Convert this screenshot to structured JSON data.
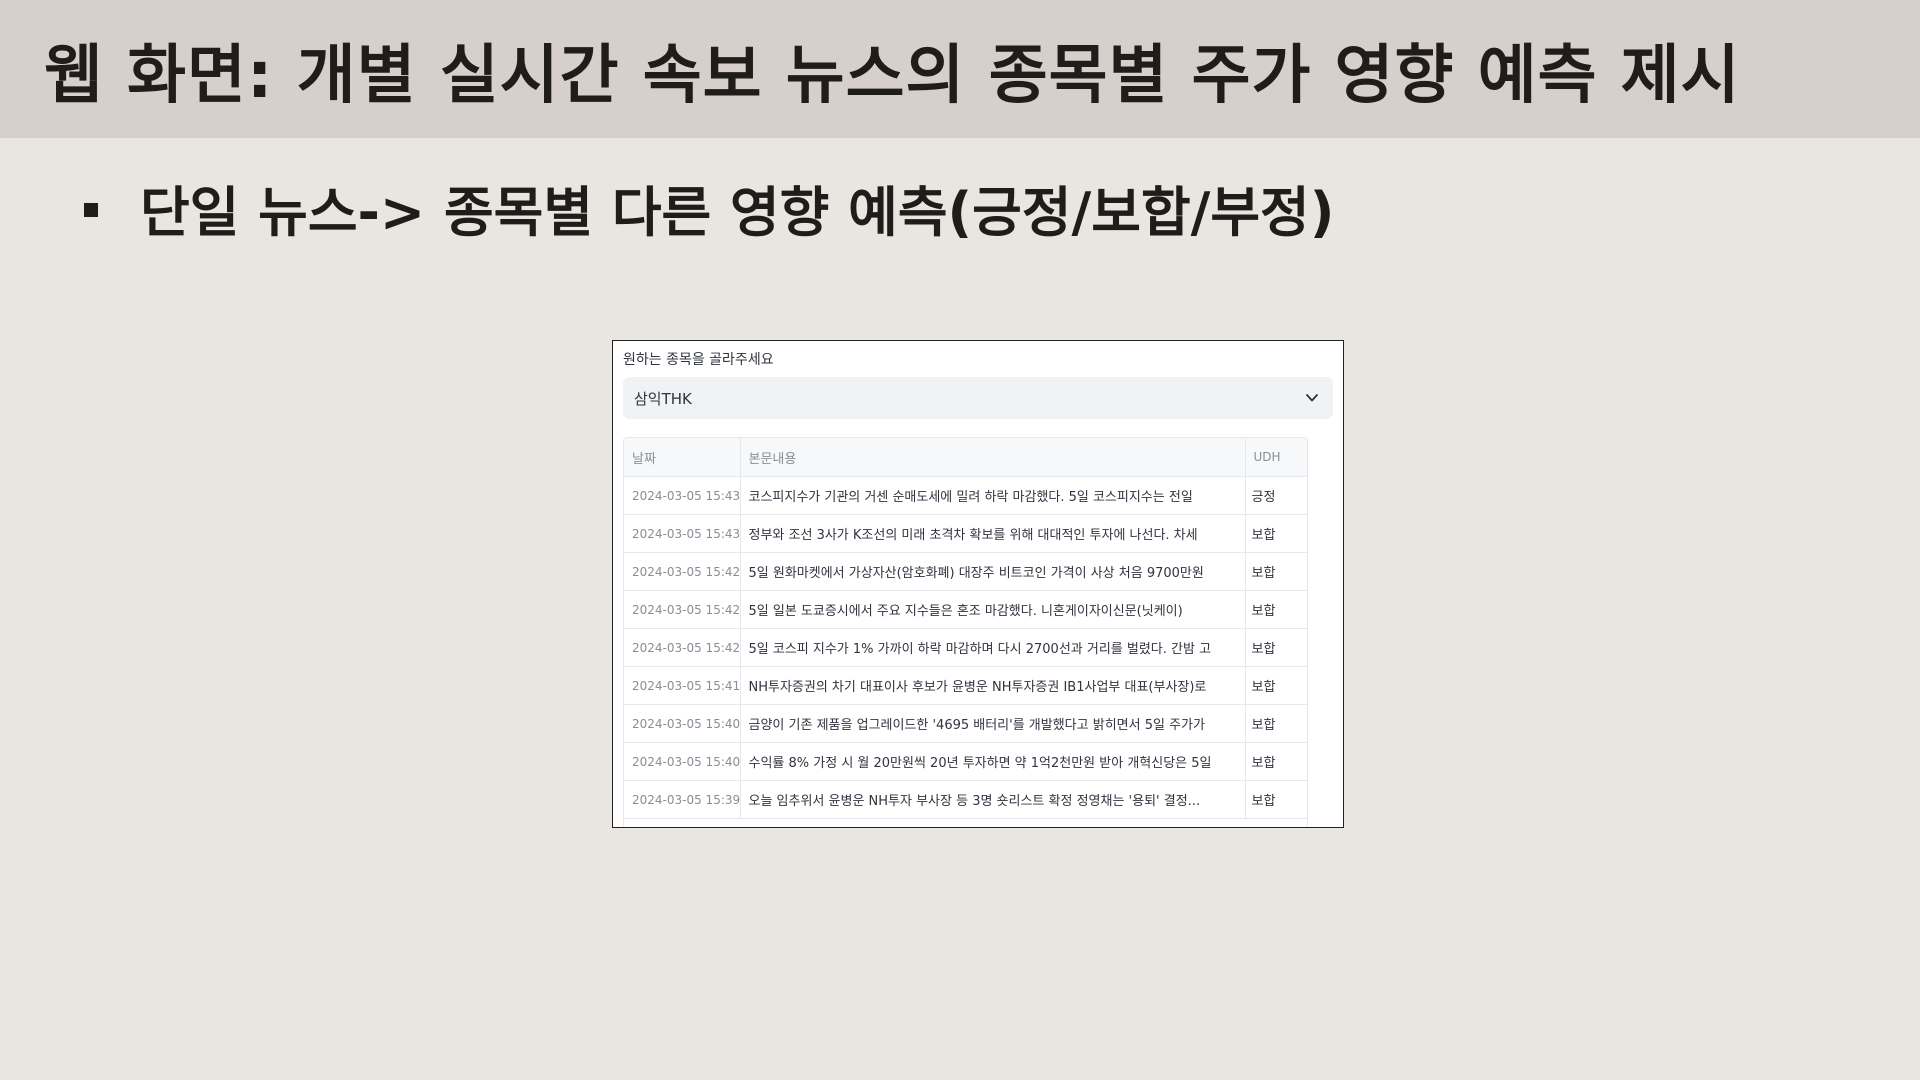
{
  "slide": {
    "title": "웹 화면: 개별 실시간 속보 뉴스의 종목별 주가 영향 예측 제시",
    "bullet": "단일 뉴스-> 종목별 다른 영향 예측(긍정/보합/부정)"
  },
  "app": {
    "select_label": "원하는 종목을 골라주세요",
    "selected_stock": "삼익THK",
    "table": {
      "columns": [
        "날짜",
        "본문내용",
        "UDH"
      ],
      "rows": [
        {
          "date": "2024-03-05 15:43",
          "body": "코스피지수가 기관의 거센 순매도세에 밀려 하락 마감했다. 5일 코스피지수는 전일",
          "udh": "긍정"
        },
        {
          "date": "2024-03-05 15:43",
          "body": "정부와 조선 3사가 K조선의 미래 초격차 확보를 위해 대대적인 투자에 나선다. 차세",
          "udh": "보합"
        },
        {
          "date": "2024-03-05 15:42",
          "body": "5일 원화마켓에서 가상자산(암호화폐) 대장주 비트코인 가격이 사상 처음 9700만원",
          "udh": "보합"
        },
        {
          "date": "2024-03-05 15:42",
          "body": "5일 일본 도쿄증시에서 주요 지수들은 혼조 마감했다. 니혼게이자이신문(닛케이)",
          "udh": "보합"
        },
        {
          "date": "2024-03-05 15:42",
          "body": "5일 코스피 지수가 1% 가까이 하락 마감하며 다시 2700선과 거리를 벌렸다. 간밤 고",
          "udh": "보합"
        },
        {
          "date": "2024-03-05 15:41",
          "body": "NH투자증권의 차기 대표이사 후보가 윤병운 NH투자증권 IB1사업부 대표(부사장)로",
          "udh": "보합"
        },
        {
          "date": "2024-03-05 15:40",
          "body": "금양이 기존 제품을 업그레이드한 '4695 배터리'를 개발했다고 밝히면서 5일 주가가",
          "udh": "보합"
        },
        {
          "date": "2024-03-05 15:40",
          "body": "수익률 8% 가정 시 월 20만원씩 20년 투자하면 약 1억2천만원 받아 개혁신당은 5일",
          "udh": "보합"
        },
        {
          "date": "2024-03-05 15:39",
          "body": "오늘 임추위서 윤병운 NH투자 부사장 등 3명 숏리스트 확정 정영채는 '용퇴' 결정...",
          "udh": "보합"
        }
      ]
    }
  },
  "icons": {
    "select_chevron": "chevron-down-icon",
    "bullet": "square-bullet"
  },
  "colors": {
    "title_bar": "#d6cfcb",
    "background": "#e9e5e0",
    "text": "#1f1c1a"
  }
}
